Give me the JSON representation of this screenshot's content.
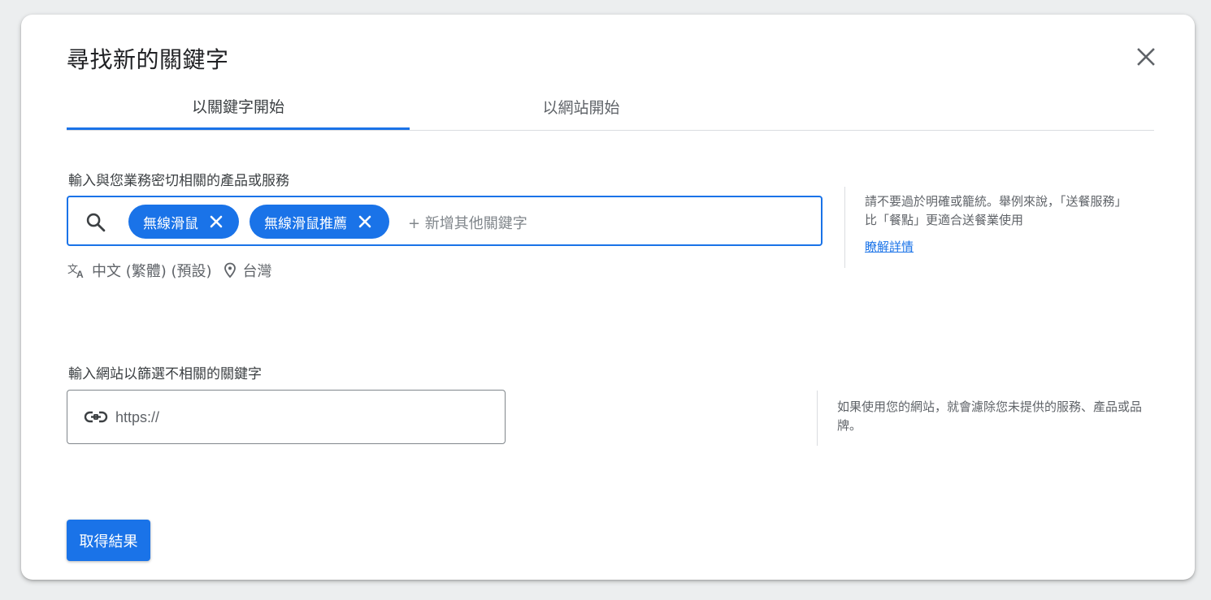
{
  "dialog": {
    "title": "尋找新的關鍵字",
    "close_icon": "close-icon"
  },
  "tabs": [
    {
      "label": "以關鍵字開始",
      "active": true
    },
    {
      "label": "以網站開始",
      "active": false
    }
  ],
  "keywords_section": {
    "label": "輸入與您業務密切相關的產品或服務",
    "search_icon": "search-icon",
    "chips": [
      {
        "label": "無線滑鼠"
      },
      {
        "label": "無線滑鼠推薦"
      }
    ],
    "add_placeholder": "+ 新增其他關鍵字",
    "language": "中文 (繁體) (預設)",
    "location": "台灣",
    "hint_text": "請不要過於明確或籠統。舉例來說，「送餐服務」比「餐點」更適合送餐業使用",
    "hint_link": "瞭解詳情"
  },
  "website_section": {
    "label": "輸入網站以篩選不相關的關鍵字",
    "url_placeholder": "https://",
    "hint_text": "如果使用您的網站，就會濾除您未提供的服務、產品或品牌。"
  },
  "submit_label": "取得結果",
  "colors": {
    "accent": "#1a73e8",
    "text": "#3c4043",
    "muted": "#5f6368"
  }
}
